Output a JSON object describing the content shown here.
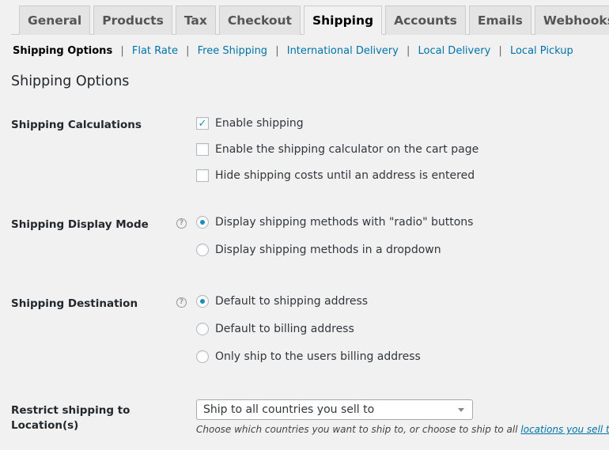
{
  "tabs": [
    {
      "label": "General",
      "active": false
    },
    {
      "label": "Products",
      "active": false
    },
    {
      "label": "Tax",
      "active": false
    },
    {
      "label": "Checkout",
      "active": false
    },
    {
      "label": "Shipping",
      "active": true
    },
    {
      "label": "Accounts",
      "active": false
    },
    {
      "label": "Emails",
      "active": false
    },
    {
      "label": "Webhooks",
      "active": false
    }
  ],
  "subnav": {
    "current": "Shipping Options",
    "links": [
      "Flat Rate",
      "Free Shipping",
      "International Delivery",
      "Local Delivery",
      "Local Pickup"
    ],
    "separator": "|"
  },
  "section_title": "Shipping Options",
  "shipping_calculations": {
    "label": "Shipping Calculations",
    "options": [
      {
        "label": "Enable shipping",
        "checked": true
      },
      {
        "label": "Enable the shipping calculator on the cart page",
        "checked": false
      },
      {
        "label": "Hide shipping costs until an address is entered",
        "checked": false
      }
    ]
  },
  "display_mode": {
    "label": "Shipping Display Mode",
    "help_icon": "?",
    "options": [
      {
        "label": "Display shipping methods with \"radio\" buttons",
        "selected": true
      },
      {
        "label": "Display shipping methods in a dropdown",
        "selected": false
      }
    ]
  },
  "destination": {
    "label": "Shipping Destination",
    "help_icon": "?",
    "options": [
      {
        "label": "Default to shipping address",
        "selected": true
      },
      {
        "label": "Default to billing address",
        "selected": false
      },
      {
        "label": "Only ship to the users billing address",
        "selected": false
      }
    ]
  },
  "restrict": {
    "label_line1": "Restrict shipping to",
    "label_line2": "Location(s)",
    "selected": "Ship to all countries you sell to",
    "description": "Choose which countries you want to ship to, or choose to ship to all ",
    "description_link": "locations you sell to",
    "description_end": "."
  },
  "colors": {
    "accent": "#1e8cbe",
    "link": "#0073aa",
    "background": "#f1f1f1"
  }
}
